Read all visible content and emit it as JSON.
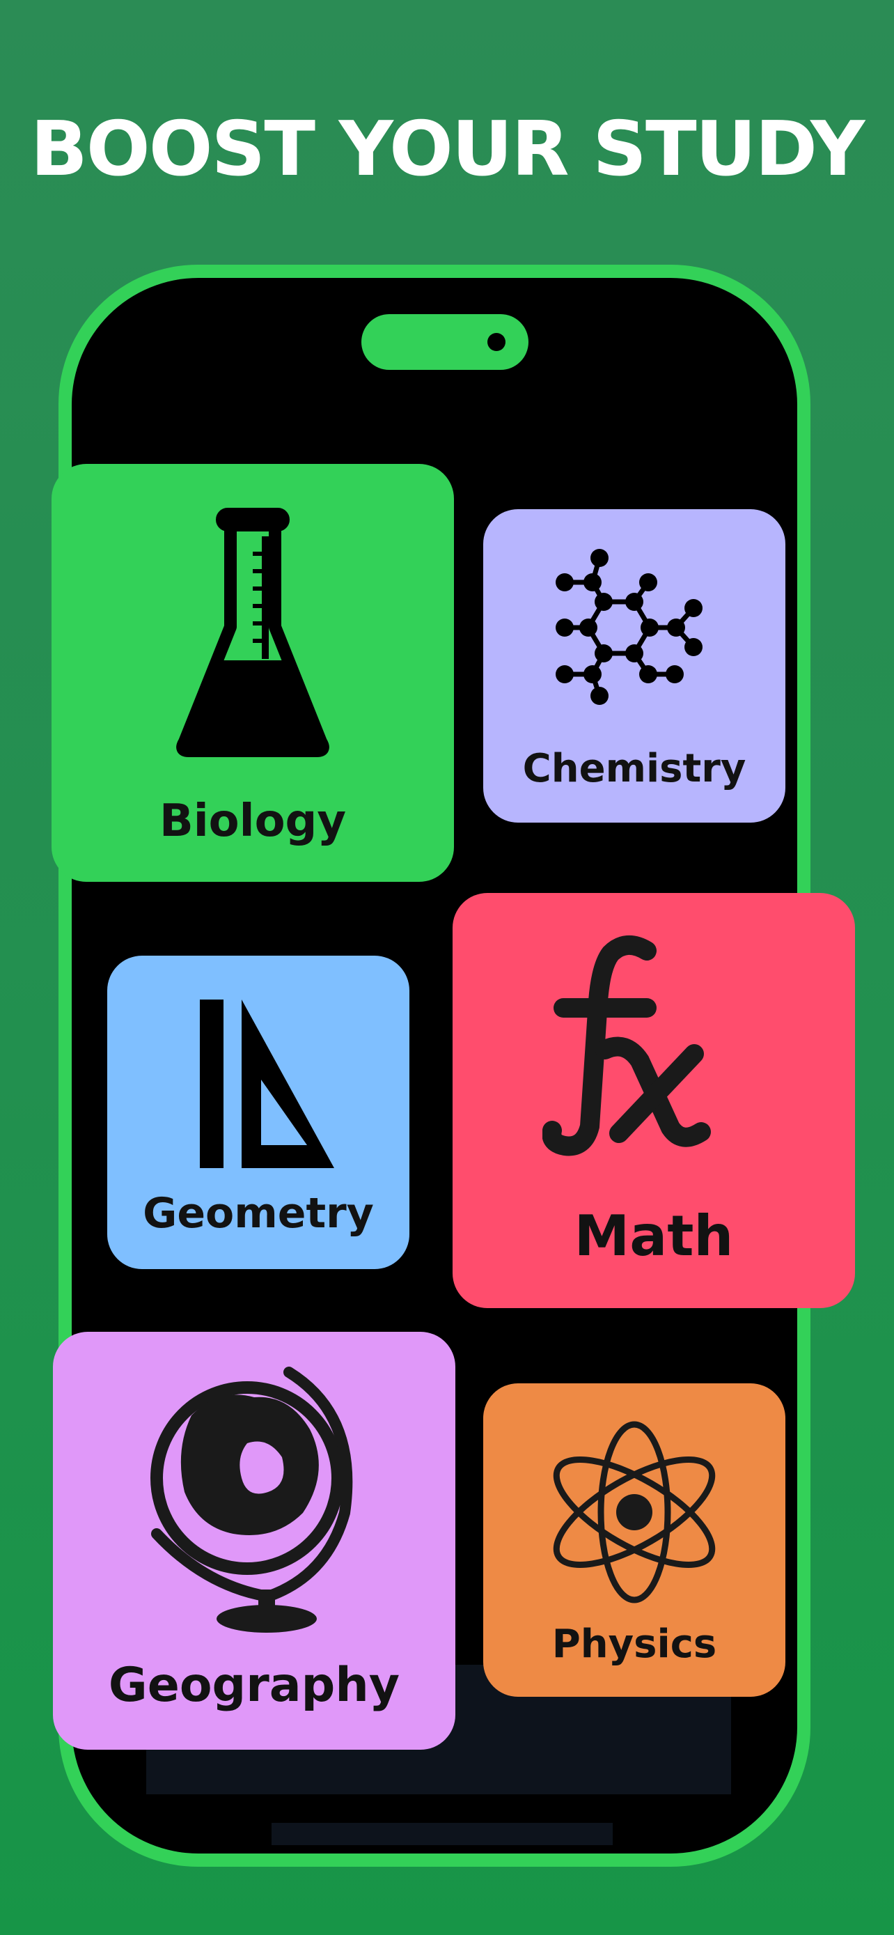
{
  "headline": "BOOST YOUR STUDY",
  "colors": {
    "background": "#238f51",
    "phone_frame": "#33d158",
    "screen": "#000000",
    "biology": "#33d158",
    "chemistry": "#b7b5fe",
    "geometry": "#7fbfff",
    "math": "#ff4d6d",
    "geography": "#e098f9",
    "physics": "#ee8a45"
  },
  "subjects": [
    {
      "label": "Biology",
      "icon": "flask-icon"
    },
    {
      "label": "Chemistry",
      "icon": "molecule-icon"
    },
    {
      "label": "Geometry",
      "icon": "set-square-icon"
    },
    {
      "label": "Math",
      "icon": "function-icon"
    },
    {
      "label": "Geography",
      "icon": "globe-icon"
    },
    {
      "label": "Physics",
      "icon": "atom-icon"
    }
  ]
}
